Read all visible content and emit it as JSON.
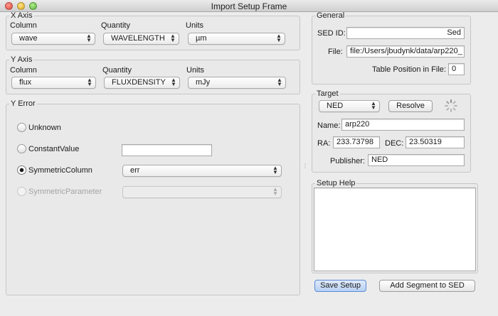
{
  "window": {
    "title": "Import Setup Frame"
  },
  "x_axis": {
    "legend": "X Axis",
    "column_label": "Column",
    "quantity_label": "Quantity",
    "units_label": "Units",
    "column": "wave",
    "quantity": "WAVELENGTH",
    "units": "µm"
  },
  "y_axis": {
    "legend": "Y Axis",
    "column_label": "Column",
    "quantity_label": "Quantity",
    "units_label": "Units",
    "column": "flux",
    "quantity": "FLUXDENSITY",
    "units": "mJy"
  },
  "y_error": {
    "legend": "Y Error",
    "options": [
      {
        "label": "Unknown",
        "selected": false,
        "enabled": true
      },
      {
        "label": "ConstantValue",
        "selected": false,
        "enabled": true
      },
      {
        "label": "SymmetricColumn",
        "selected": true,
        "enabled": true
      },
      {
        "label": "SymmetricParameter",
        "selected": false,
        "enabled": false
      }
    ],
    "constant_value": "",
    "symmetric_column": "err",
    "symmetric_parameter": ""
  },
  "general": {
    "legend": "General",
    "sed_id_label": "SED ID:",
    "sed_id": "Sed",
    "file_label": "File:",
    "file": "file:/Users/jbudynk/data/arp220_",
    "table_position_label": "Table Position in File:",
    "table_position": "0"
  },
  "target": {
    "legend": "Target",
    "service": "NED",
    "resolve_label": "Resolve",
    "name_label": "Name:",
    "name": "arp220",
    "ra_label": "RA:",
    "ra": "233.73798",
    "dec_label": "DEC:",
    "dec": "23.50319",
    "publisher_label": "Publisher:",
    "publisher": "NED"
  },
  "setup_help": {
    "legend": "Setup Help",
    "content": ""
  },
  "buttons": {
    "save_setup": "Save Setup",
    "add_segment": "Add Segment to SED"
  }
}
